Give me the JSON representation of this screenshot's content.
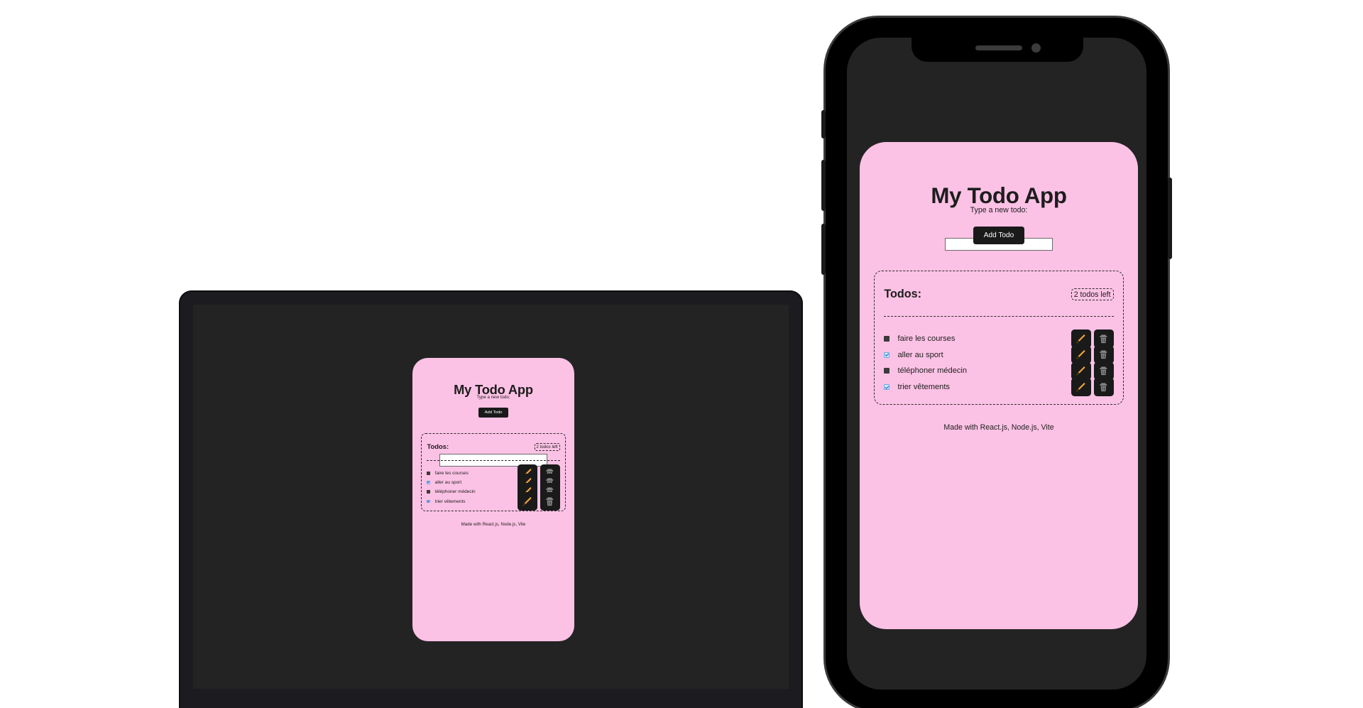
{
  "app": {
    "title": "My Todo App",
    "prompt": "Type a new todo:",
    "input_value": "",
    "add_button": "Add Todo",
    "todos_label": "Todos:",
    "todos_left": "2 todos left",
    "items": [
      {
        "text": "faire les courses",
        "done": false
      },
      {
        "text": "aller au sport",
        "done": true
      },
      {
        "text": "téléphoner médecin",
        "done": false
      },
      {
        "text": "trier vêtements",
        "done": true
      }
    ],
    "footer": "Made with React.js, Node.js, Vite"
  },
  "icons": {
    "edit": "pencil-icon",
    "delete": "trash-icon"
  },
  "colors": {
    "card": "#fcc2e5",
    "screen": "#232323",
    "button": "#1a1a1a",
    "pencil": "#f2a33a",
    "trash": "#8a8a8a"
  }
}
